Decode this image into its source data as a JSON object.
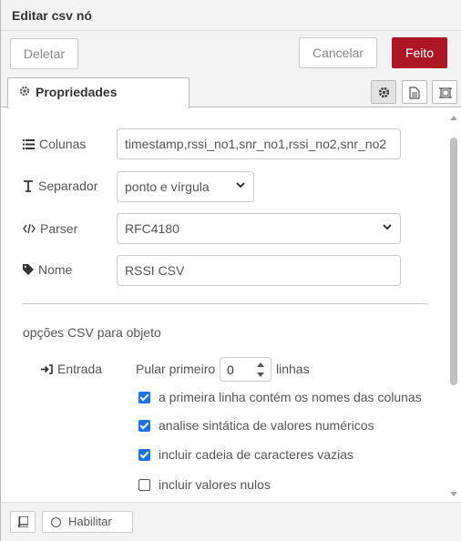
{
  "dialog": {
    "title": "Editar csv nó"
  },
  "toolbar": {
    "delete_label": "Deletar",
    "cancel_label": "Cancelar",
    "done_label": "Feito"
  },
  "tabs": {
    "properties_label": "Propriedades",
    "icons": [
      "gear-icon",
      "document-icon",
      "frame-icon"
    ]
  },
  "form": {
    "columns": {
      "label": "Colunas",
      "value": "timestamp,rssi_no1,snr_no1,rssi_no2,snr_no2"
    },
    "separator": {
      "label": "Separador",
      "value": "ponto e vírgula"
    },
    "parser": {
      "label": "Parser",
      "value": "RFC4180"
    },
    "name": {
      "label": "Nome",
      "value": "RSSI CSV"
    }
  },
  "csv_options": {
    "section_title": "opções CSV para objeto",
    "input_label": "Entrada",
    "skip_prefix": "Pular primeiro",
    "skip_value": "0",
    "skip_suffix": "linhas",
    "checkboxes": [
      {
        "label": "a primeira linha contém os nomes das colunas",
        "checked": true
      },
      {
        "label": "analise sintática de valores numéricos",
        "checked": true
      },
      {
        "label": "incluir cadeia de caracteres vazias",
        "checked": true
      },
      {
        "label": "incluir valores nulos",
        "checked": false
      }
    ]
  },
  "footer": {
    "enable_label": "Habilitar"
  },
  "colors": {
    "done_button": "#ad1625",
    "checkbox_checked": "#1a73e8"
  }
}
